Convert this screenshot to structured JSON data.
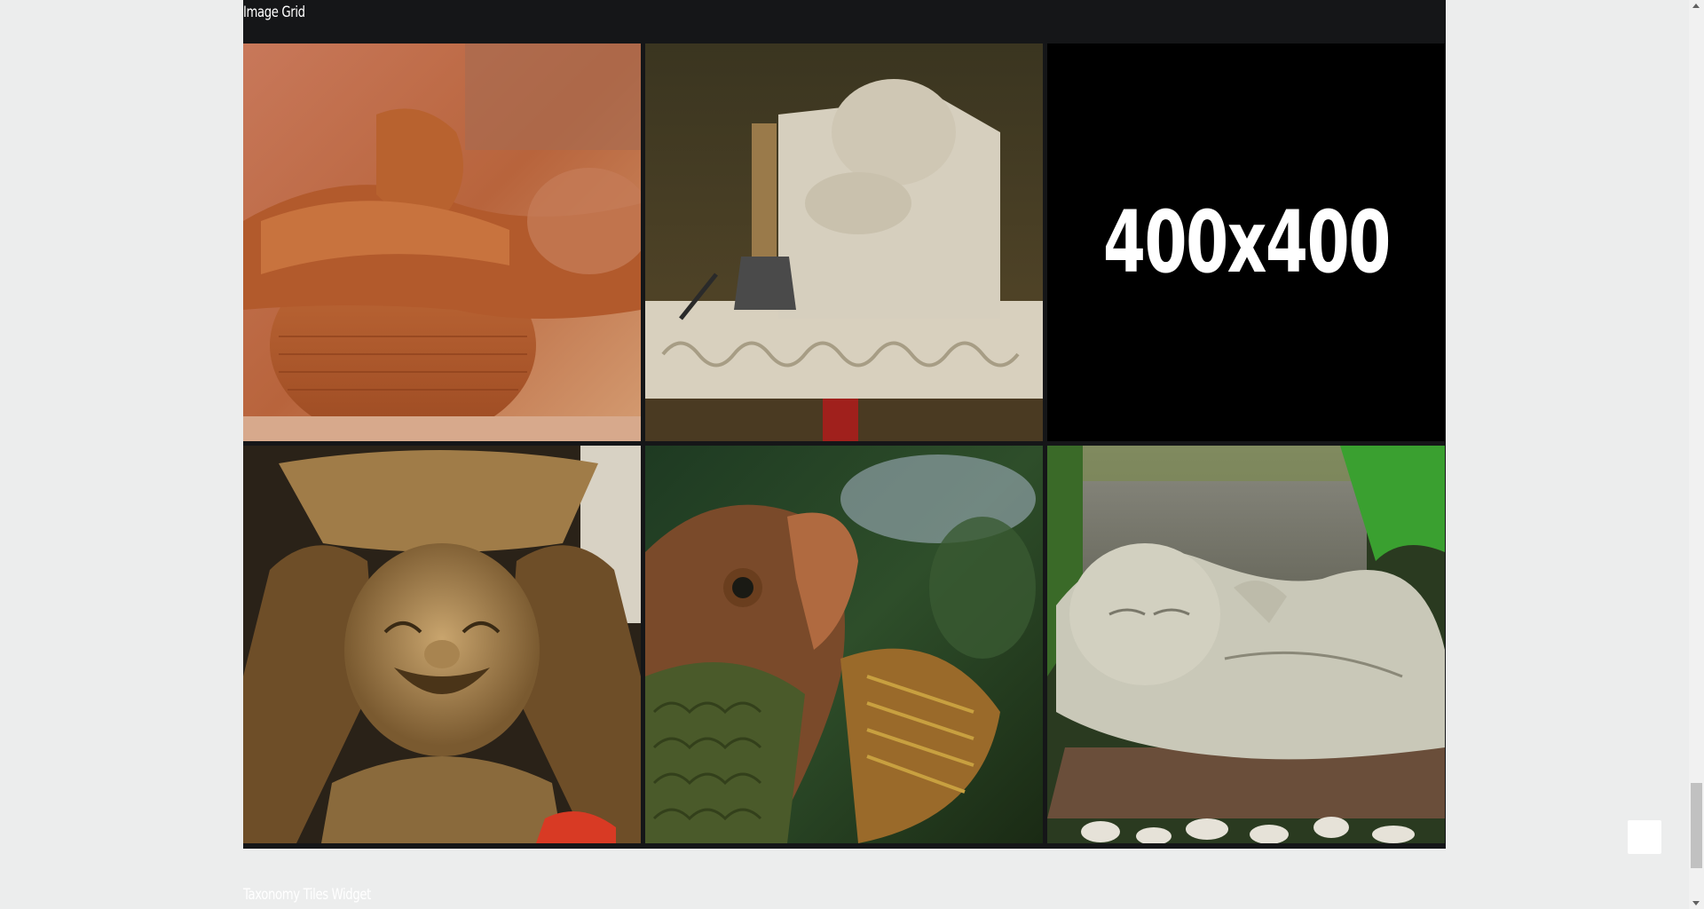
{
  "widget": {
    "title": "Image Grid",
    "images": [
      {
        "subject": "potter hands shaping clay pot",
        "caption": ""
      },
      {
        "subject": "stone carving with chisel",
        "caption": ""
      },
      {
        "subject": "placeholder",
        "caption": "400x400"
      },
      {
        "subject": "laughing buddha statue",
        "caption": ""
      },
      {
        "subject": "carved fish sculpture",
        "caption": ""
      },
      {
        "subject": "sleeping child stone statue",
        "caption": ""
      }
    ]
  },
  "next_section": {
    "title": "Taxonomy Tiles Widget"
  },
  "icons": {
    "back_to_top": "back-to-top-icon",
    "scroll_up": "scroll-up-arrow-icon",
    "scroll_down": "scroll-down-arrow-icon"
  },
  "colors": {
    "widget_background": "#151618",
    "page_background": "#eceded",
    "title_text": "#ffffff"
  }
}
